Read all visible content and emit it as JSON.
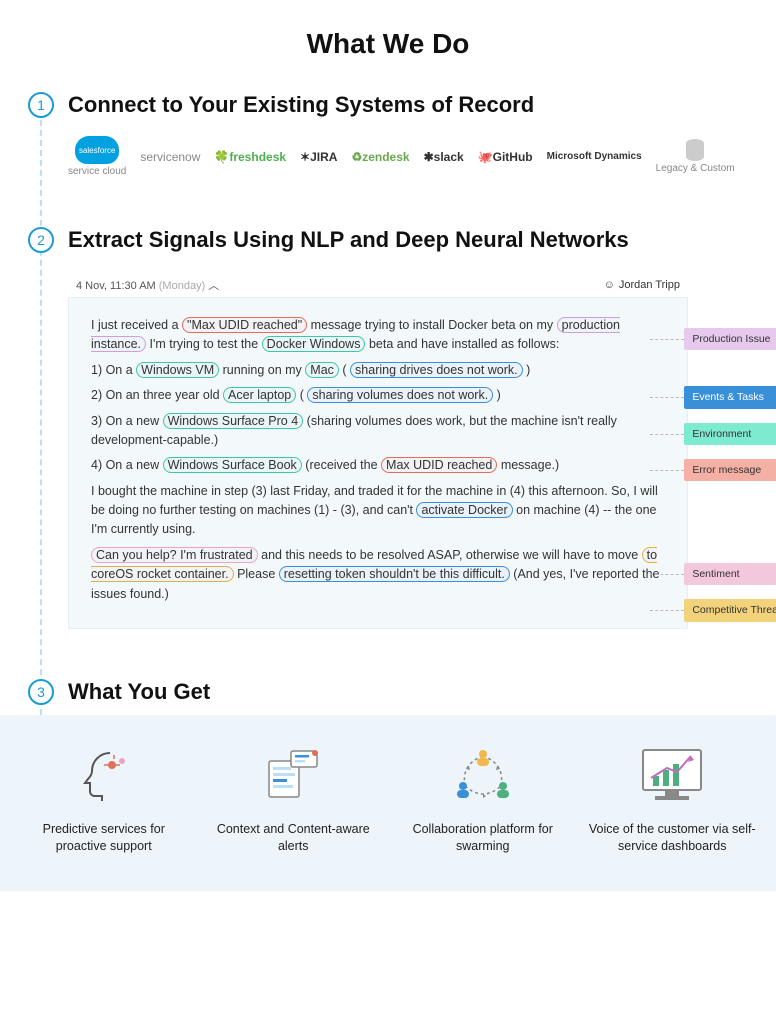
{
  "title": "What We Do",
  "steps": [
    {
      "num": "1",
      "heading": "Connect to Your Existing Systems of Record"
    },
    {
      "num": "2",
      "heading": "Extract Signals Using NLP and Deep Neural Networks"
    },
    {
      "num": "3",
      "heading": "What You Get"
    }
  ],
  "integrations": {
    "salesforce": "salesforce",
    "salesforce_sub": "service cloud",
    "servicenow": "servicenow",
    "freshdesk": "freshdesk",
    "jira": "JIRA",
    "zendesk": "zendesk",
    "slack": "slack",
    "github": "GitHub",
    "msdynamics": "Microsoft Dynamics",
    "legacy": "Legacy & Custom"
  },
  "message": {
    "date": "4 Nov, 11:30 AM",
    "day": "(Monday)",
    "user": "Jordan Tripp",
    "t_pre1": "I just received a ",
    "t_max_udid_q": "\"Max UDID reached\"",
    "t_post1": " message trying to install Docker beta on my ",
    "t_prod_inst": "production instance.",
    "t_post1b": "  I'm trying to test the ",
    "t_docker_win": "Docker Windows",
    "t_post1c": " beta and have installed as follows:",
    "l1a": " 1) On a ",
    "l1_winvm": "Windows VM",
    "l1b": " running on my ",
    "l1_mac": "Mac",
    "l1c": "  (",
    "l1_share": "sharing drives does not work.",
    "l1d": ")",
    "l2a": " 2) On an three year old ",
    "l2_acer": "Acer laptop",
    "l2b": " (",
    "l2_share": "sharing volumes does not work.",
    "l2c": ")",
    "l3a": " 3) On a new ",
    "l3_sp4": "Windows Surface Pro 4",
    "l3b": " (sharing volumes does work, but the machine isn't really development-capable.)",
    "l4a": " 4) On a new ",
    "l4_sb": "Windows Surface Book",
    "l4b": " (received the ",
    "l4_max": "Max UDID reached",
    "l4c": " message.)",
    "p5a": " I bought the machine in step (3) last Friday, and traded it for the machine in (4) this afternoon.  So, I will be doing no further testing on machines (1) - (3), and can't ",
    "p5_act": "activate Docker",
    "p5b": " on machine (4) -- the one I'm currently using.",
    "p6_help": "Can you help? I'm frustrated",
    "p6a": " and this needs to be resolved ASAP, otherwise we will have to move ",
    "p6_core": "to coreOS rocket container.",
    "p6b": " Please ",
    "p6_reset": "resetting token shouldn't be this difficult.",
    "p6c": " (And yes, I've reported the issues found.)"
  },
  "callouts": {
    "prod": "Production Issue",
    "events": "Events & Tasks",
    "env": "Environment",
    "err": "Error message",
    "sent": "Sentiment",
    "comp": "Competitive Threads"
  },
  "benefits": [
    "Predictive services for proactive support",
    "Context and Content-aware alerts",
    "Collaboration platform for swarming",
    "Voice of the customer via self-service dashboards"
  ]
}
